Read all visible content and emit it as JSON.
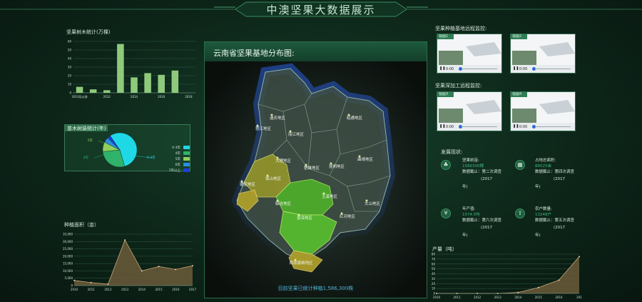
{
  "header": {
    "title": "中澳坚果大数据展示"
  },
  "left": {
    "tree_chart_title": "坚果树木统计(万棵)",
    "seedling_title": "苗木树装统计(年)",
    "area_title": "种植面积（亩）"
  },
  "map": {
    "title": "云南省坚果基地分布图:",
    "footer": "目前坚果已统计种植1,586,300株",
    "regions": [
      "迪庆地区",
      "怒江地区",
      "丽江地区",
      "昭通地区",
      "大理地区",
      "楚雄地区",
      "昆明地区",
      "曲靖地区",
      "德宏地区",
      "保山地区",
      "临沧地区",
      "玉溪地区",
      "文山地区",
      "普洱地区",
      "红河地区",
      "西双版纳地区"
    ]
  },
  "right": {
    "base_monitor_title": "坚果种植基地远程监控:",
    "process_monitor_title": "坚果深加工远程监控:",
    "videos": [
      {
        "label": "视图1",
        "time": "0:00"
      },
      {
        "label": "视图2",
        "time": "0:00"
      },
      {
        "label": "视图3",
        "time": "0:00"
      },
      {
        "label": "视图4",
        "time": "0:00"
      }
    ],
    "development_title": "发展现状:",
    "development": [
      {
        "icon": "tree-icon",
        "name": "坚果树苗:",
        "value": "1586300棵",
        "note": "数据截止：第二次调查",
        "year": "(2017",
        "year_end": "年)"
      },
      {
        "icon": "land-icon",
        "name": "占地总面积:",
        "value": "88025亩",
        "note": "数据截止：第四次调查",
        "year": "(2017",
        "year_end": "年)"
      },
      {
        "icon": "coin-icon",
        "name": "年产值:",
        "value": "1574.5吨",
        "note": "数据截止：第六次调查",
        "year": "(2017",
        "year_end": "年)"
      },
      {
        "icon": "upload-icon",
        "name": "农户数量:",
        "value": "13248户",
        "note": "数据截止：第五次调查",
        "year": "(2017",
        "year_end": "年)"
      }
    ],
    "output_title": "产量（吨）"
  },
  "chart_data": [
    {
      "type": "bar",
      "title": "坚果树木统计(万棵)",
      "categories": [
        "2010及以前",
        "2011",
        "2012",
        "2013",
        "2014",
        "2015",
        "2016",
        "2017",
        "2018"
      ],
      "tick_labels": [
        "2010及以前",
        "2012",
        "2014",
        "2016",
        "2018"
      ],
      "values": [
        7,
        4,
        3,
        57,
        18,
        23,
        21,
        26,
        0
      ],
      "ylim": [
        0,
        60
      ],
      "yticks": [
        0,
        10,
        20,
        30,
        40,
        50,
        60
      ],
      "color": "#8fc97c"
    },
    {
      "type": "pie",
      "title": "苗木树装统计(年)",
      "slices": [
        {
          "name": "0-3年",
          "value": 55,
          "color": "#1fd8e6"
        },
        {
          "name": "4年",
          "value": 28,
          "color": "#2fb36a"
        },
        {
          "name": "5年",
          "value": 9,
          "color": "#8fd05c"
        },
        {
          "name": "6年",
          "value": 5,
          "color": "#2a8fe0"
        },
        {
          "name": "7年以上",
          "value": 3,
          "color": "#1a3fd8"
        }
      ],
      "callouts": [
        "5年",
        "4年",
        "0-3年"
      ]
    },
    {
      "type": "area",
      "title": "种植面积（亩）",
      "x": [
        "2010",
        "2011",
        "2012",
        "2013",
        "2014",
        "2015",
        "2016",
        "2017"
      ],
      "values": [
        3500,
        2000,
        1000,
        31000,
        10000,
        13000,
        11000,
        13500
      ],
      "ylim": [
        0,
        35000
      ],
      "yticks": [
        "0",
        "5,000",
        "10,000",
        "15,000",
        "20,000",
        "25,000",
        "30,000",
        "35,000"
      ],
      "fill": "#6b5a3a",
      "line": "#c9a574"
    },
    {
      "type": "area",
      "title": "产量（吨）",
      "x": [
        "2010",
        "2011",
        "2012",
        "2013",
        "2014",
        "2015",
        "2016",
        "2017"
      ],
      "tick_labels": [
        "2010",
        "2011",
        "2012",
        "2013",
        "2014",
        "2015",
        "2016",
        "201"
      ],
      "values": [
        0,
        0,
        0,
        0,
        2,
        12,
        27,
        75
      ],
      "ylim": [
        0,
        80
      ],
      "yticks": [
        0,
        10,
        20,
        30,
        40,
        50,
        60,
        70,
        80
      ],
      "fill": "#6b5a3a",
      "line": "#c9a574"
    }
  ]
}
